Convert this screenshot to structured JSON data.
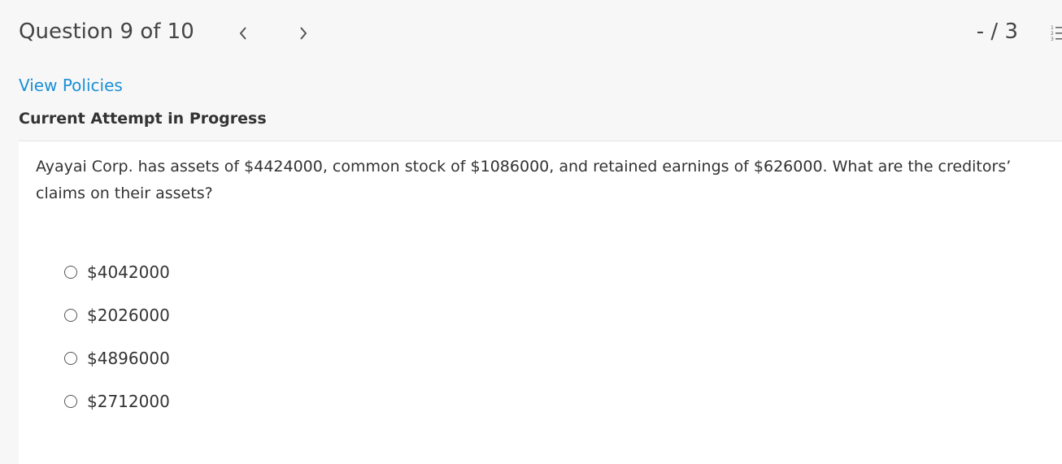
{
  "header": {
    "question_position": "Question 9 of 10",
    "prev_icon": "chevron-left-icon",
    "next_icon": "chevron-right-icon",
    "score": "- / 3",
    "list_icon": "numbered-list-icon"
  },
  "links": {
    "view_policies": "View Policies"
  },
  "status": {
    "attempt": "Current Attempt in Progress"
  },
  "question": {
    "text": "Ayayai Corp. has assets of $4424000, common stock of $1086000, and retained earnings of $626000. What are the creditors’ claims on their assets?",
    "options": [
      {
        "label": "$4042000",
        "selected": false
      },
      {
        "label": "$2026000",
        "selected": false
      },
      {
        "label": "$4896000",
        "selected": false
      },
      {
        "label": "$2712000",
        "selected": false
      }
    ]
  },
  "colors": {
    "link": "#1a8fd6",
    "background": "#f7f7f7",
    "panel": "#ffffff"
  }
}
